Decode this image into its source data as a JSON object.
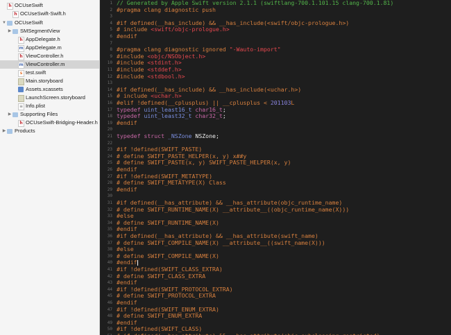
{
  "navigator": {
    "rows": [
      {
        "label": "OCUseSwift",
        "icon": "header-file-icon",
        "depth": 0,
        "disclosure": "",
        "selected": false
      },
      {
        "label": "OCUseSwift-Swift.h",
        "icon": "header-file-icon",
        "depth": 1,
        "disclosure": "",
        "selected": false
      },
      {
        "label": "OCUseSwift",
        "icon": "folder-icon",
        "depth": 0,
        "disclosure": "▼",
        "selected": false
      },
      {
        "label": "SMSegmentView",
        "icon": "folder-icon",
        "depth": 1,
        "disclosure": "▶",
        "selected": false
      },
      {
        "label": "AppDelegate.h",
        "icon": "header-file-icon",
        "depth": 2,
        "disclosure": "",
        "selected": false
      },
      {
        "label": "AppDelegate.m",
        "icon": "objc-file-icon",
        "depth": 2,
        "disclosure": "",
        "selected": false
      },
      {
        "label": "ViewController.h",
        "icon": "header-file-icon",
        "depth": 2,
        "disclosure": "",
        "selected": false
      },
      {
        "label": "ViewController.m",
        "icon": "objc-file-icon",
        "depth": 2,
        "disclosure": "",
        "selected": true
      },
      {
        "label": "test.swift",
        "icon": "swift-file-icon",
        "depth": 2,
        "disclosure": "",
        "selected": false
      },
      {
        "label": "Main.storyboard",
        "icon": "storyboard-icon",
        "depth": 2,
        "disclosure": "",
        "selected": false
      },
      {
        "label": "Assets.xcassets",
        "icon": "assets-icon",
        "depth": 2,
        "disclosure": "",
        "selected": false
      },
      {
        "label": "LaunchScreen.storyboard",
        "icon": "storyboard-icon",
        "depth": 2,
        "disclosure": "",
        "selected": false
      },
      {
        "label": "Info.plist",
        "icon": "plist-icon",
        "depth": 2,
        "disclosure": "",
        "selected": false
      },
      {
        "label": "Supporting Files",
        "icon": "folder-icon",
        "depth": 1,
        "disclosure": "▶",
        "selected": false
      },
      {
        "label": "OCUseSwift-Bridging-Header.h",
        "icon": "header-file-icon",
        "depth": 2,
        "disclosure": "",
        "selected": false
      },
      {
        "label": "Products",
        "icon": "folder-icon",
        "depth": 0,
        "disclosure": "▶",
        "selected": false
      }
    ]
  },
  "editor": {
    "lines": [
      {
        "n": "1",
        "t": [
          [
            "c",
            "// Generated by Apple Swift version 2.1.1 (swiftlang-700.1.101.15 clang-700.1.81)"
          ]
        ]
      },
      {
        "n": "2",
        "t": [
          [
            "p",
            "#pragma clang diagnostic push"
          ]
        ]
      },
      {
        "n": "3",
        "t": []
      },
      {
        "n": "4",
        "t": [
          [
            "p",
            "#if defined(__has_include) && __has_include(<swift/objc-prologue.h>)"
          ]
        ]
      },
      {
        "n": "5",
        "t": [
          [
            "p",
            "# include "
          ],
          [
            "s",
            "<swift/objc-prologue.h>"
          ]
        ]
      },
      {
        "n": "6",
        "t": [
          [
            "p",
            "#endif"
          ]
        ]
      },
      {
        "n": "7",
        "t": []
      },
      {
        "n": "8",
        "t": [
          [
            "p",
            "#pragma clang diagnostic ignored "
          ],
          [
            "s",
            "\"-Wauto-import\""
          ]
        ]
      },
      {
        "n": "9",
        "t": [
          [
            "p",
            "#include "
          ],
          [
            "s",
            "<objc/NSObject.h>"
          ]
        ]
      },
      {
        "n": "10",
        "t": [
          [
            "p",
            "#include "
          ],
          [
            "s",
            "<stdint.h>"
          ]
        ]
      },
      {
        "n": "11",
        "t": [
          [
            "p",
            "#include "
          ],
          [
            "s",
            "<stddef.h>"
          ]
        ]
      },
      {
        "n": "12",
        "t": [
          [
            "p",
            "#include "
          ],
          [
            "s",
            "<stdbool.h>"
          ]
        ]
      },
      {
        "n": "13",
        "t": []
      },
      {
        "n": "14",
        "t": [
          [
            "p",
            "#if defined(__has_include) && __has_include(<uchar.h>)"
          ]
        ]
      },
      {
        "n": "15",
        "t": [
          [
            "p",
            "# include "
          ],
          [
            "s",
            "<uchar.h>"
          ]
        ]
      },
      {
        "n": "16",
        "t": [
          [
            "p",
            "#elif !defined(__cplusplus) || __cplusplus < "
          ],
          [
            "n",
            "201103"
          ],
          [
            "p",
            "L"
          ]
        ]
      },
      {
        "n": "17",
        "t": [
          [
            "k",
            "typedef "
          ],
          [
            "y",
            "uint_least16_t "
          ],
          [
            "k",
            "char16_t"
          ],
          [
            "w",
            ";"
          ]
        ]
      },
      {
        "n": "18",
        "t": [
          [
            "k",
            "typedef "
          ],
          [
            "y",
            "uint_least32_t "
          ],
          [
            "k",
            "char32_t"
          ],
          [
            "w",
            ";"
          ]
        ]
      },
      {
        "n": "19",
        "t": [
          [
            "p",
            "#endif"
          ]
        ]
      },
      {
        "n": "20",
        "t": []
      },
      {
        "n": "21",
        "t": [
          [
            "k",
            "typedef struct "
          ],
          [
            "y",
            "_NSZone "
          ],
          [
            "w",
            "NSZone;"
          ]
        ]
      },
      {
        "n": "22",
        "t": []
      },
      {
        "n": "23",
        "t": [
          [
            "p",
            "#if !defined(SWIFT_PASTE)"
          ]
        ]
      },
      {
        "n": "24",
        "t": [
          [
            "p",
            "# define SWIFT_PASTE_HELPER(x, y) x##y"
          ]
        ]
      },
      {
        "n": "25",
        "t": [
          [
            "p",
            "# define SWIFT_PASTE(x, y) SWIFT_PASTE_HELPER(x, y)"
          ]
        ]
      },
      {
        "n": "26",
        "t": [
          [
            "p",
            "#endif"
          ]
        ]
      },
      {
        "n": "27",
        "t": [
          [
            "p",
            "#if !defined(SWIFT_METATYPE)"
          ]
        ]
      },
      {
        "n": "28",
        "t": [
          [
            "p",
            "# define SWIFT_METATYPE(X) Class"
          ]
        ]
      },
      {
        "n": "29",
        "t": [
          [
            "p",
            "#endif"
          ]
        ]
      },
      {
        "n": "30",
        "t": []
      },
      {
        "n": "31",
        "t": [
          [
            "p",
            "#if defined(__has_attribute) && __has_attribute(objc_runtime_name)"
          ]
        ]
      },
      {
        "n": "32",
        "t": [
          [
            "p",
            "# define SWIFT_RUNTIME_NAME(X) __attribute__((objc_runtime_name(X)))"
          ]
        ]
      },
      {
        "n": "33",
        "t": [
          [
            "p",
            "#else"
          ]
        ]
      },
      {
        "n": "34",
        "t": [
          [
            "p",
            "# define SWIFT_RUNTIME_NAME(X)"
          ]
        ]
      },
      {
        "n": "35",
        "t": [
          [
            "p",
            "#endif"
          ]
        ]
      },
      {
        "n": "36",
        "t": [
          [
            "p",
            "#if defined(__has_attribute) && __has_attribute(swift_name)"
          ]
        ]
      },
      {
        "n": "37",
        "t": [
          [
            "p",
            "# define SWIFT_COMPILE_NAME(X) __attribute__((swift_name(X)))"
          ]
        ]
      },
      {
        "n": "38",
        "t": [
          [
            "p",
            "#else"
          ]
        ]
      },
      {
        "n": "39",
        "t": [
          [
            "p",
            "# define SWIFT_COMPILE_NAME(X)"
          ]
        ]
      },
      {
        "n": "40",
        "t": [
          [
            "p",
            "#endif"
          ],
          [
            "cursor",
            ""
          ]
        ]
      },
      {
        "n": "41",
        "t": [
          [
            "p",
            "#if !defined(SWIFT_CLASS_EXTRA)"
          ]
        ]
      },
      {
        "n": "42",
        "t": [
          [
            "p",
            "# define SWIFT_CLASS_EXTRA"
          ]
        ]
      },
      {
        "n": "43",
        "t": [
          [
            "p",
            "#endif"
          ]
        ]
      },
      {
        "n": "44",
        "t": [
          [
            "p",
            "#if !defined(SWIFT_PROTOCOL_EXTRA)"
          ]
        ]
      },
      {
        "n": "45",
        "t": [
          [
            "p",
            "# define SWIFT_PROTOCOL_EXTRA"
          ]
        ]
      },
      {
        "n": "46",
        "t": [
          [
            "p",
            "#endif"
          ]
        ]
      },
      {
        "n": "47",
        "t": [
          [
            "p",
            "#if !defined(SWIFT_ENUM_EXTRA)"
          ]
        ]
      },
      {
        "n": "48",
        "t": [
          [
            "p",
            "# define SWIFT_ENUM_EXTRA"
          ]
        ]
      },
      {
        "n": "49",
        "t": [
          [
            "p",
            "#endif"
          ]
        ]
      },
      {
        "n": "50",
        "t": [
          [
            "p",
            "#if !defined(SWIFT_CLASS)"
          ]
        ]
      },
      {
        "n": "51",
        "t": [
          [
            "p",
            "# if defined(__has_attribute) && __has_attribute(objc_subclassing_restricted)"
          ]
        ]
      }
    ]
  },
  "colors": {
    "comment": "#53b54a",
    "preprocessor": "#d8803e",
    "string": "#e6484e",
    "keyword": "#c767a6",
    "type": "#7b8fe0",
    "number": "#8a84e0",
    "editor_bg": "#1e1e1e",
    "navigator_bg": "#f5f5f5",
    "selection": "#d4d4d4"
  }
}
